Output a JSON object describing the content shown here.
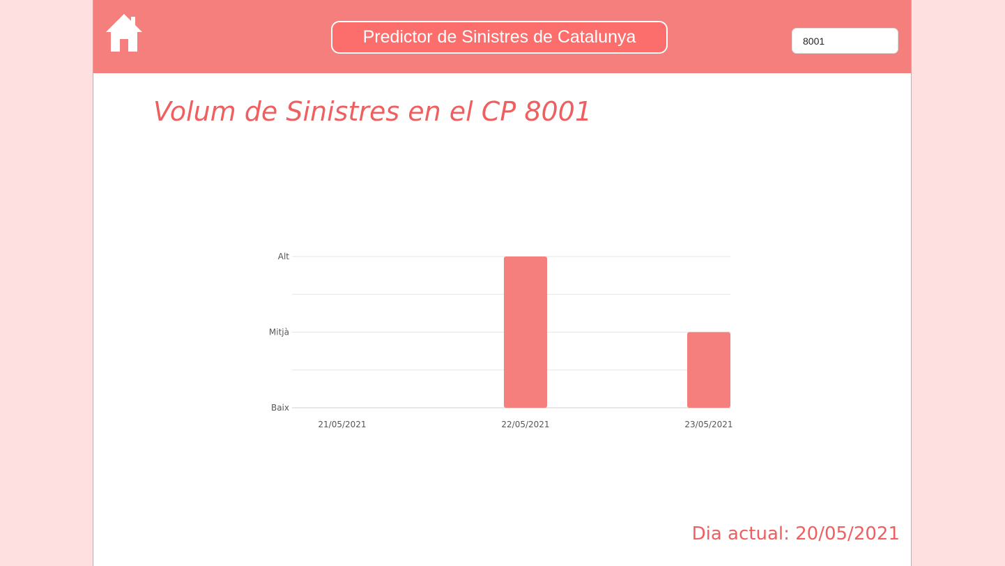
{
  "header": {
    "title": "Predictor de Sinistres de Catalunya",
    "search_value": "8001",
    "home_icon": "home-icon"
  },
  "main": {
    "title": "Volum de Sinistres en el CP 8001"
  },
  "footer": {
    "current_date": "Dia actual: 20/05/2021"
  },
  "colors": {
    "brand": "#f47f7c",
    "title_box": "#fb6e6c",
    "accent_text": "#ef5f5f",
    "bar": "#f47f7c",
    "side_background": "#ffe0e1"
  },
  "chart_data": {
    "type": "bar",
    "title": "",
    "xlabel": "",
    "ylabel": "",
    "categories": [
      "21/05/2021",
      "22/05/2021",
      "23/05/2021"
    ],
    "values": [
      0,
      2,
      1
    ],
    "y_levels": [
      "Baix",
      "Mitjà",
      "Alt"
    ],
    "ylim": [
      0,
      2
    ],
    "grid": true,
    "legend": "none"
  }
}
